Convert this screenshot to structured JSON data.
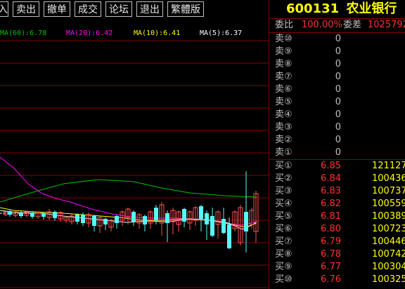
{
  "toolbar": {
    "buttons": [
      "入",
      "卖出",
      "撤单",
      "成交",
      "论坛",
      "退出",
      "繁體版"
    ]
  },
  "ma_legend": {
    "ma60": "MA(60):6.78",
    "ma20": "MA(20):6.42",
    "ma10": "MA(10):6.41",
    "ma5": "MA(5):6.37"
  },
  "stock": {
    "code": "600131",
    "name": "农业银行"
  },
  "ratio": {
    "weibi_label": "委比",
    "weibi_value": "100.00%",
    "weicha_label": "委差",
    "weicha_value": "1025792"
  },
  "sell_orders": [
    {
      "label": "卖⑩",
      "price": "0",
      "volume": ""
    },
    {
      "label": "卖⑨",
      "price": "0",
      "volume": ""
    },
    {
      "label": "卖⑧",
      "price": "0",
      "volume": ""
    },
    {
      "label": "卖⑦",
      "price": "0",
      "volume": ""
    },
    {
      "label": "卖⑥",
      "price": "0",
      "volume": ""
    },
    {
      "label": "卖⑤",
      "price": "0",
      "volume": ""
    },
    {
      "label": "卖④",
      "price": "0",
      "volume": ""
    },
    {
      "label": "卖③",
      "price": "0",
      "volume": ""
    },
    {
      "label": "卖②",
      "price": "0",
      "volume": ""
    },
    {
      "label": "卖①",
      "price": "0",
      "volume": ""
    }
  ],
  "buy_orders": [
    {
      "label": "买①",
      "price": "6.85",
      "volume": "121127"
    },
    {
      "label": "买②",
      "price": "6.84",
      "volume": "100436"
    },
    {
      "label": "买③",
      "price": "6.83",
      "volume": "100737"
    },
    {
      "label": "买④",
      "price": "6.82",
      "volume": "100559"
    },
    {
      "label": "买⑤",
      "price": "6.81",
      "volume": "100389"
    },
    {
      "label": "买⑥",
      "price": "6.80",
      "volume": "100723"
    },
    {
      "label": "买⑦",
      "price": "6.79",
      "volume": "100446"
    },
    {
      "label": "买⑧",
      "price": "6.78",
      "volume": "100742"
    },
    {
      "label": "买⑨",
      "price": "6.77",
      "volume": "100304"
    },
    {
      "label": "买⑩",
      "price": "6.76",
      "volume": "100325"
    }
  ],
  "colors": {
    "background": "#000000",
    "up": "#ff5050",
    "down": "#54fcfc",
    "grid": "#8b0000",
    "ma5": "#ffffff",
    "ma10": "#ffff00",
    "ma20": "#ff00ff",
    "ma60": "#00c000",
    "title": "#ffff00",
    "price_red": "#ff3232",
    "volume": "#ffff00"
  }
}
